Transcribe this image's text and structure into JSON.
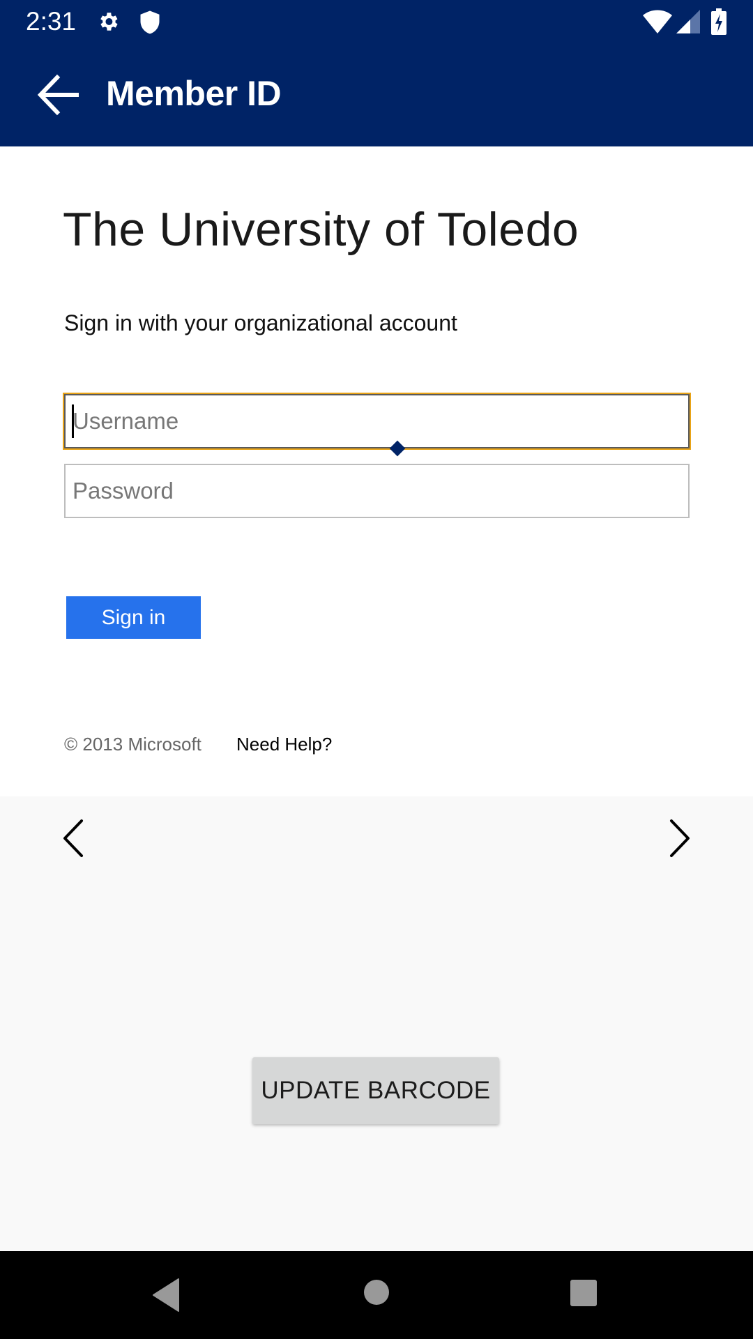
{
  "status_bar": {
    "time": "2:31",
    "icons": [
      "gear-icon",
      "shield-icon",
      "wifi-icon",
      "signal-icon",
      "battery-charging-icon"
    ]
  },
  "app_bar": {
    "title": "Member ID",
    "back_icon": "arrow-left-icon",
    "background_color": "#002366"
  },
  "login": {
    "organization": "The University of Toledo",
    "subtitle": "Sign in with your organizational account",
    "username": {
      "value": "",
      "placeholder": "Username",
      "focused": true
    },
    "password": {
      "value": "",
      "placeholder": "Password"
    },
    "sign_in_label": "Sign in",
    "sign_in_color": "#2672EC",
    "copyright": "© 2013 Microsoft",
    "help_link": "Need Help?",
    "focus_color": "#E8A317"
  },
  "carousel": {
    "prev_icon": "chevron-left-icon",
    "next_icon": "chevron-right-icon"
  },
  "actions": {
    "update_barcode_label": "UPDATE BARCODE"
  },
  "nav_bar": {
    "buttons": [
      "nav-back-icon",
      "nav-home-icon",
      "nav-recents-icon"
    ]
  }
}
